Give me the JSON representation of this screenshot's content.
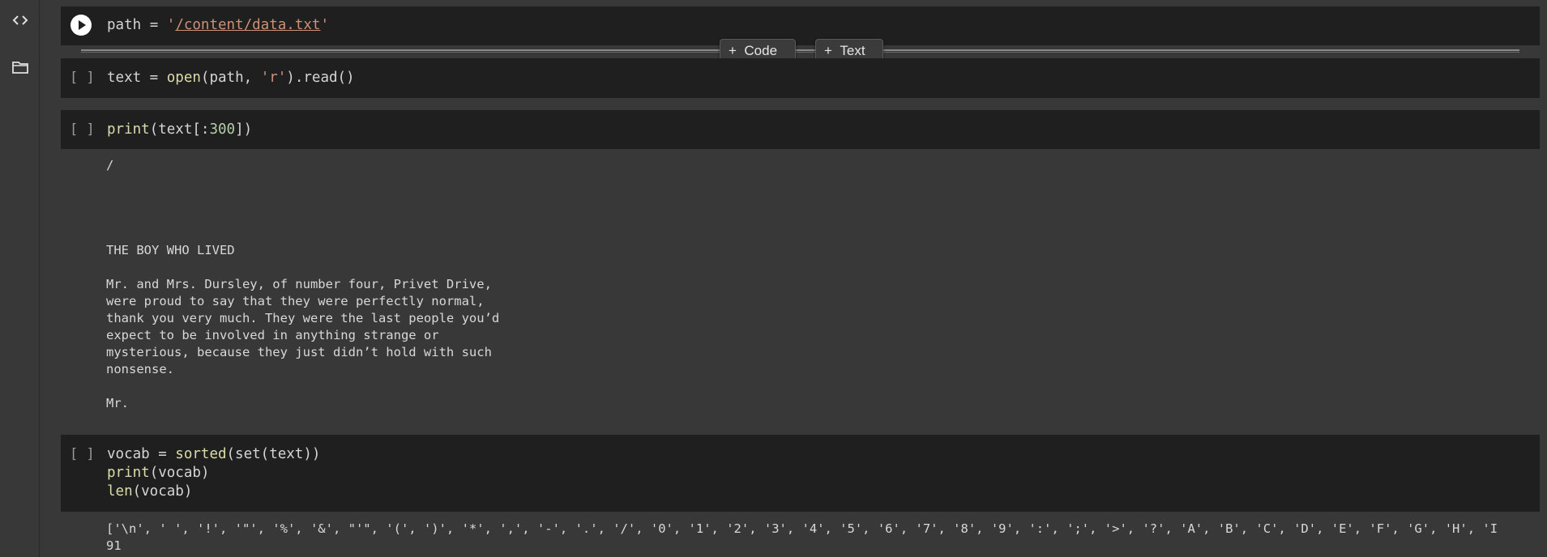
{
  "rail": {
    "code_icon": "code-brackets-icon",
    "folder_icon": "folder-icon"
  },
  "cells": [
    {
      "gutter": "",
      "code": {
        "var": "path",
        "op": " = ",
        "q1": "'",
        "path": "/content/data.txt",
        "q2": "'"
      }
    },
    {
      "gutter": "[ ]",
      "code": {
        "p1": "text = ",
        "fn": "open",
        "p2": "(path, ",
        "str": "'r'",
        "p3": ").read()"
      }
    },
    {
      "gutter": "[ ]",
      "code": {
        "fn": "print",
        "p1": "(text[:",
        "num": "300",
        "p2": "])"
      },
      "output": "/\n\n\n\n\nTHE BOY WHO LIVED\n\nMr. and Mrs. Dursley, of number four, Privet Drive,\nwere proud to say that they were perfectly normal,\nthank you very much. They were the last people you’d\nexpect to be involved in anything strange or\nmysterious, because they just didn’t hold with such\nnonsense.\n\nMr."
    },
    {
      "gutter": "[ ]",
      "code": {
        "l1a": "vocab = ",
        "l1fn": "sorted",
        "l1b": "(set(text))",
        "l2fn": "print",
        "l2b": "(vocab)",
        "l3fn": "len",
        "l3b": "(vocab)"
      },
      "output": "['\\n', ' ', '!', '\"', '%', '&', \"'\", '(', ')', '*', ',', '-', '.', '/', '0', '1', '2', '3', '4', '5', '6', '7', '8', '9', ':', ';', '>', '?', 'A', 'B', 'C', 'D', 'E', 'F', 'G', 'H', 'I\n91"
    }
  ],
  "insert": {
    "code_label": "Code",
    "text_label": "Text",
    "plus": "+"
  }
}
